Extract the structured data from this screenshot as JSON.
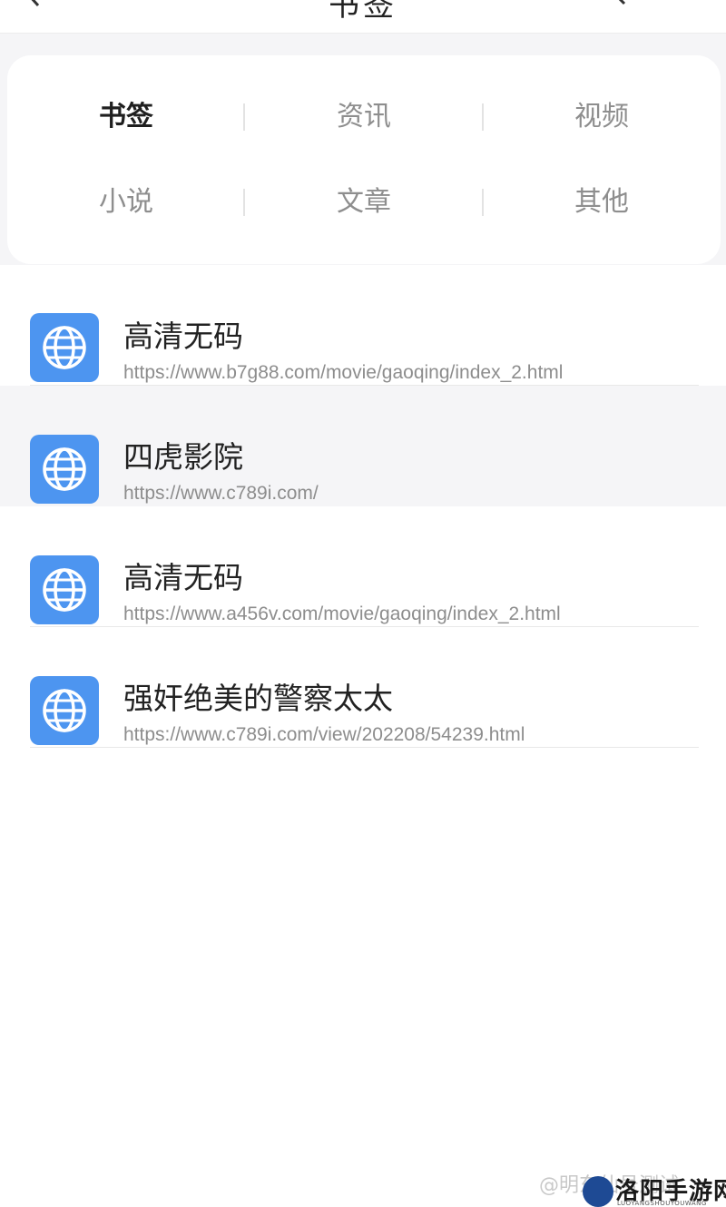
{
  "header": {
    "title": "书签",
    "back_icon": "chevron-left-icon",
    "search_icon": "search-icon"
  },
  "categories": [
    {
      "label": "书签",
      "active": true
    },
    {
      "label": "资讯",
      "active": false
    },
    {
      "label": "视频",
      "active": false
    },
    {
      "label": "小说",
      "active": false
    },
    {
      "label": "文章",
      "active": false
    },
    {
      "label": "其他",
      "active": false
    }
  ],
  "bookmarks": [
    {
      "title": "高清无码",
      "url": "https://www.b7g88.com/movie/gaoqing/index_2.html",
      "icon": "globe-icon",
      "highlighted": false
    },
    {
      "title": "四虎影院",
      "url": "https://www.c789i.com/",
      "icon": "globe-icon",
      "highlighted": true
    },
    {
      "title": "高清无码",
      "url": "https://www.a456v.com/movie/gaoqing/index_2.html",
      "icon": "globe-icon",
      "highlighted": false
    },
    {
      "title": "强奸绝美的警察太太",
      "url": "https://www.c789i.com/view/202208/54239.html",
      "icon": "globe-icon",
      "highlighted": false
    }
  ],
  "watermark": {
    "faded_text": "@明东仙号测试",
    "brand": "洛阳手游网",
    "brand_sub": "LUOYANGSHOUYOUWANG"
  },
  "colors": {
    "icon_bg": "#4d95f0",
    "active_category": "#1f1f1f",
    "inactive_category": "#8e8e8e",
    "url_text": "#8d8d8d"
  }
}
